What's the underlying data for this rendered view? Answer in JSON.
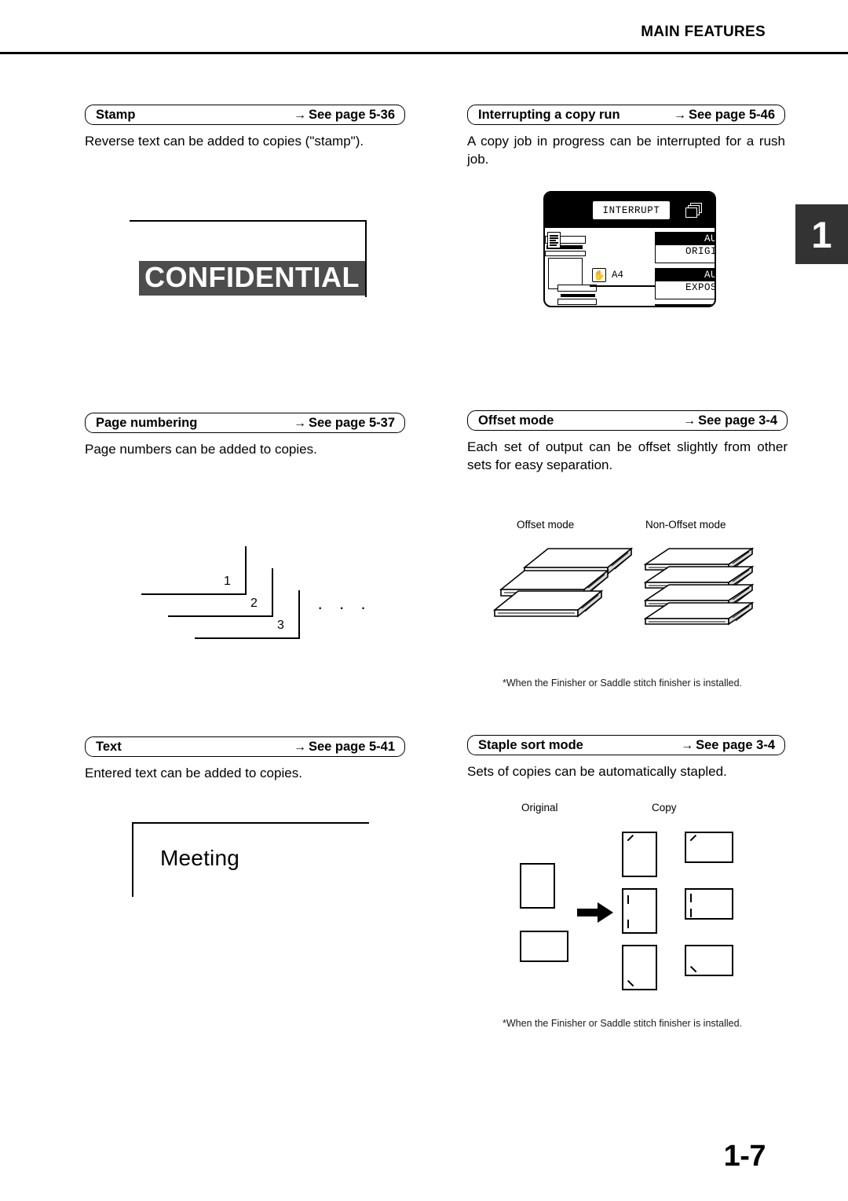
{
  "header": {
    "title": "MAIN FEATURES"
  },
  "chapter_tab": {
    "number": "1"
  },
  "footer": {
    "page_number": "1-7"
  },
  "sections": {
    "stamp": {
      "title": "Stamp",
      "arrow": "→",
      "reference": "See page 5-36",
      "body": "Reverse text can be added to copies (\"stamp\").",
      "figure": {
        "stamp_text": "CONFIDENTIAL",
        "stamp_bg_color": "#4d4d4d",
        "stamp_text_color": "#ffffff"
      }
    },
    "interrupting_a_copy_run": {
      "title": "Interrupting a copy run",
      "arrow": "→",
      "reference": "See page 5-46",
      "body": "A copy job in progress can be interrupted for a rush job.",
      "figure": {
        "interrupt_button": "INTERRUPT",
        "field_original_highlight": "AUTO",
        "field_original_label": "ORIGINA",
        "field_exposure_highlight": "AUTO",
        "field_exposure_label": "EXPOSUR",
        "paper_size": "A4"
      }
    },
    "page_numbering": {
      "title": "Page numbering",
      "arrow": "→",
      "reference": "See page 5-37",
      "body": "Page numbers can be added to copies.",
      "figure": {
        "numbers": [
          "1",
          "2",
          "3"
        ],
        "ellipsis": "· · ·"
      }
    },
    "offset_mode": {
      "title": "Offset mode",
      "arrow": "→",
      "reference": "See page 3-4",
      "body": "Each set of output can be offset slightly from other sets for easy separation.",
      "figure": {
        "label_left": "Offset mode",
        "label_right": "Non-Offset mode"
      },
      "footnote": "*When the Finisher or Saddle stitch finisher is installed."
    },
    "text": {
      "title": "Text",
      "arrow": "→",
      "reference": "See page 5-41",
      "body": "Entered text can be added to copies.",
      "figure": {
        "text_word": "Meeting"
      }
    },
    "staple_sort_mode": {
      "title": "Staple sort mode",
      "arrow": "→",
      "reference": "See page 3-4",
      "body": "Sets of copies can be automatically stapled.",
      "figure": {
        "label_original": "Original",
        "label_copy": "Copy"
      },
      "footnote": "*When the Finisher or Saddle stitch finisher is installed."
    }
  }
}
